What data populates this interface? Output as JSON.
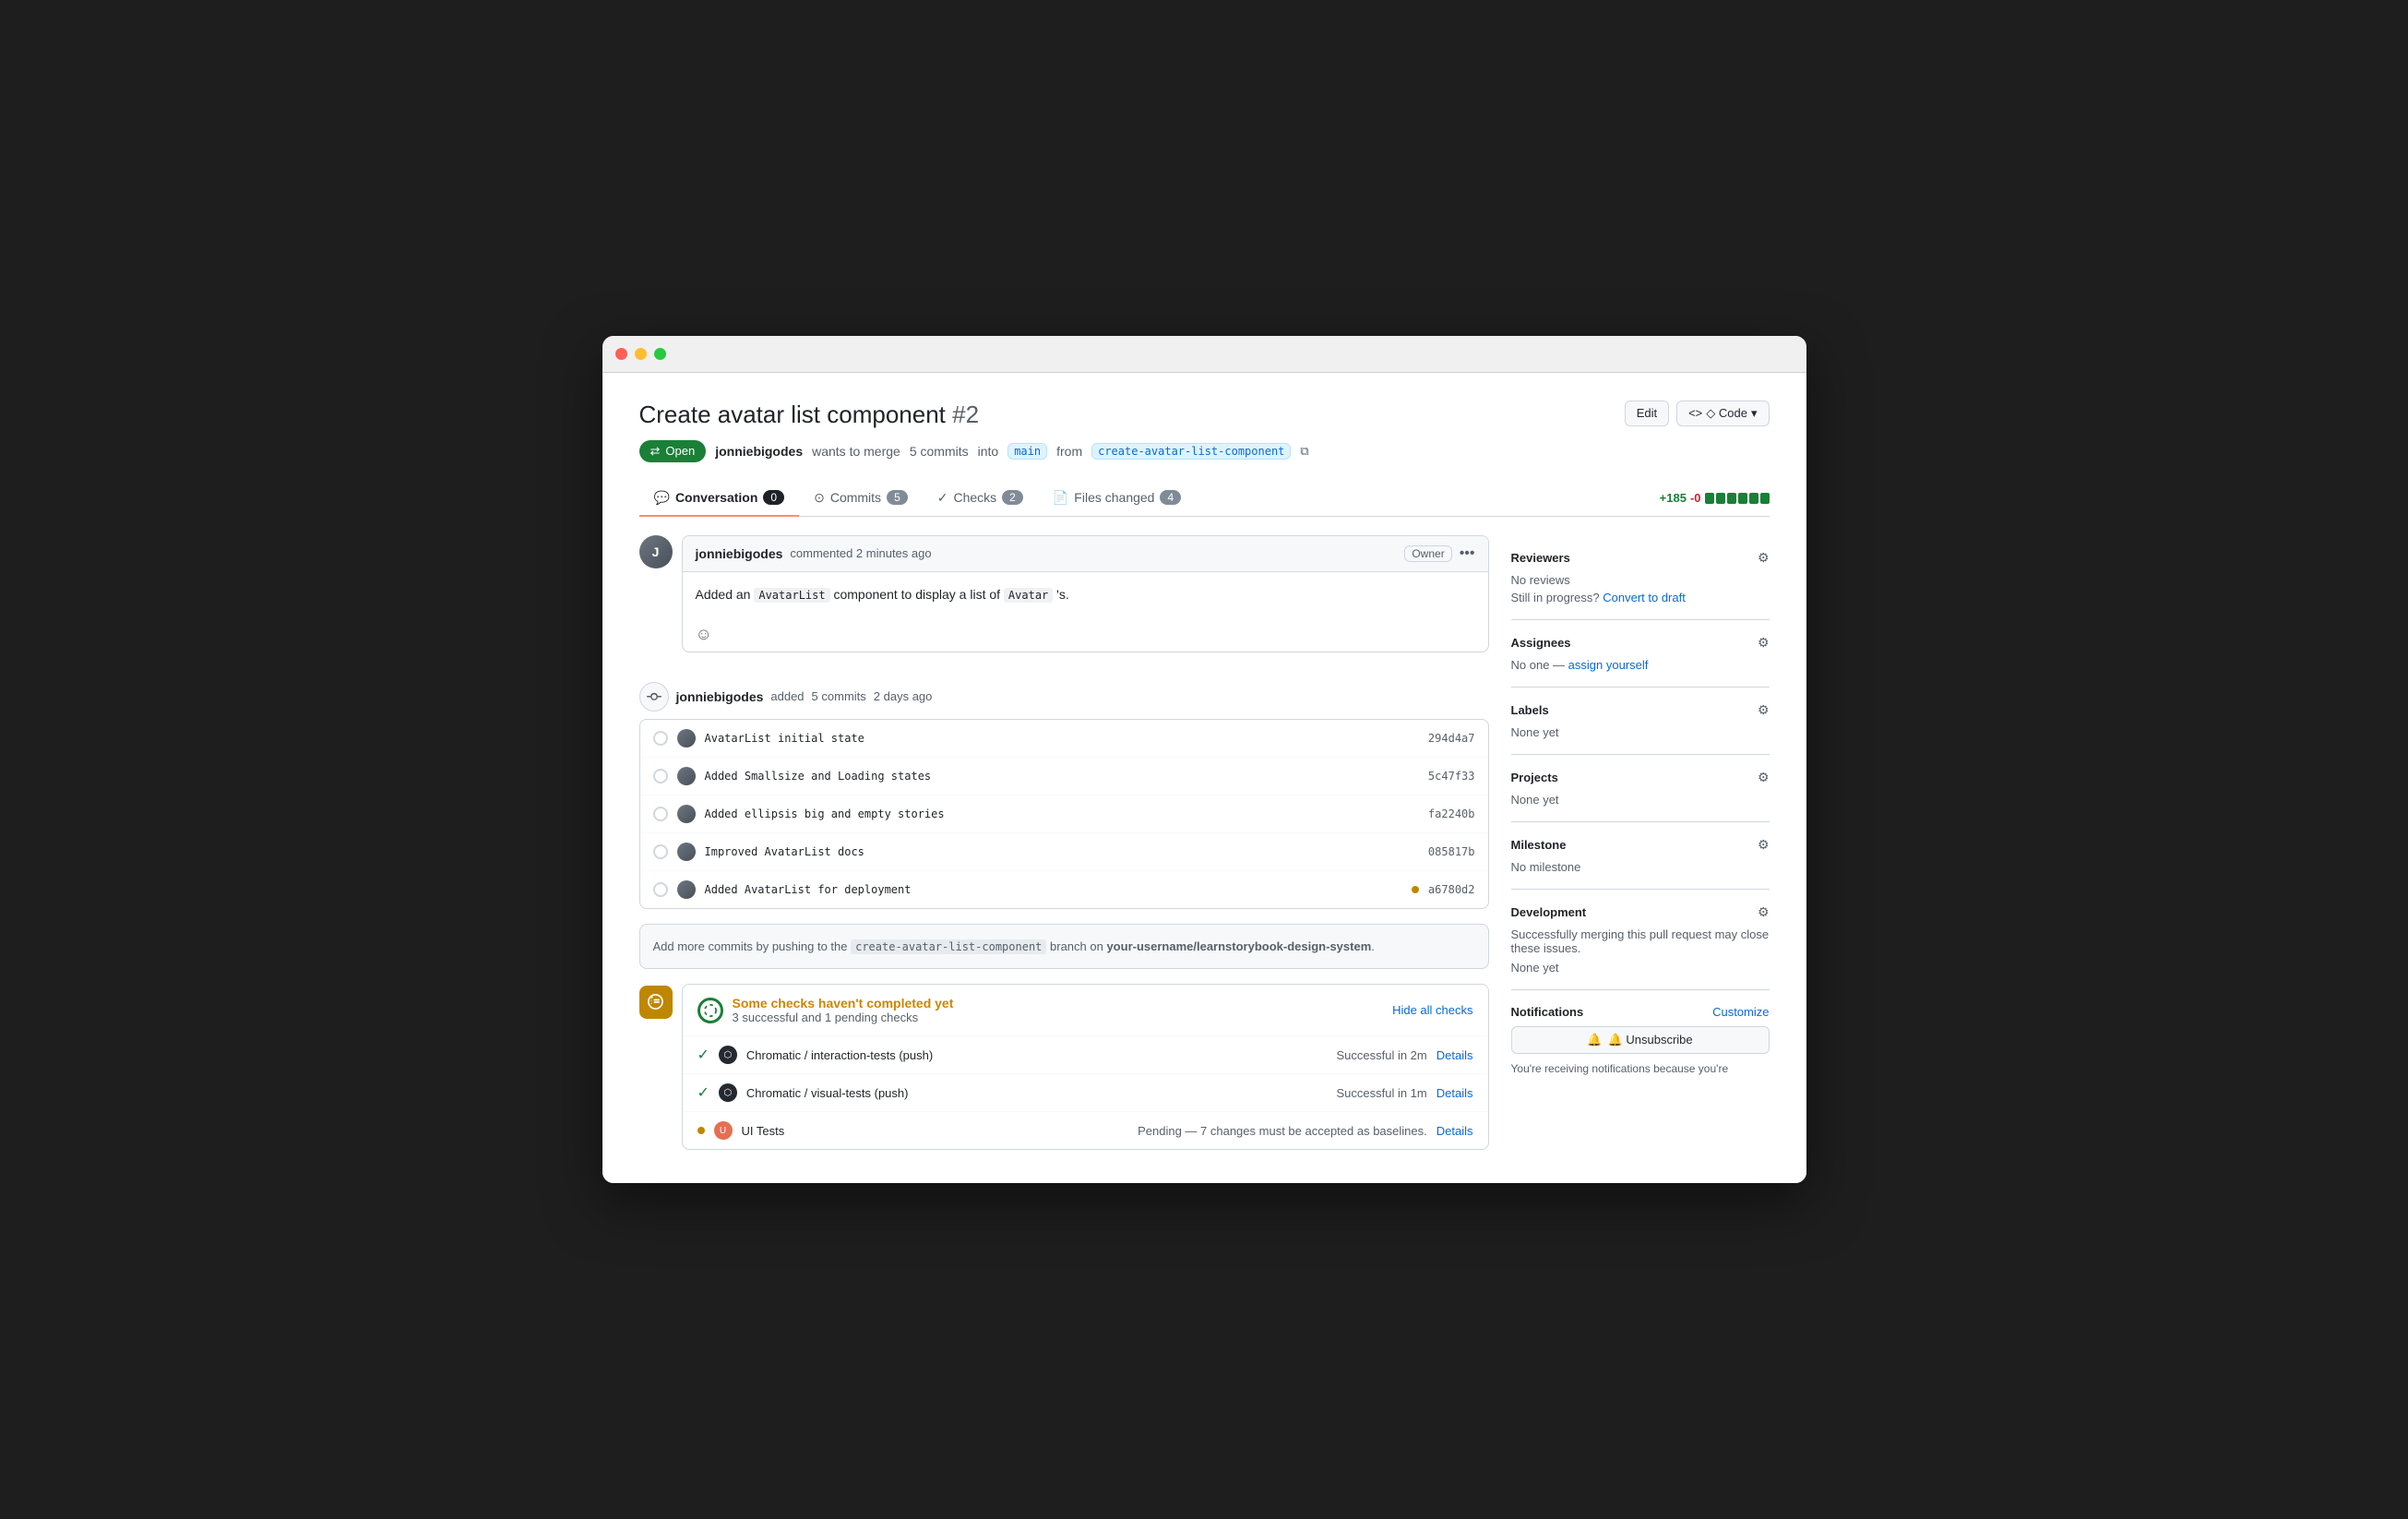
{
  "window": {
    "title": "Create avatar list component #2"
  },
  "header": {
    "pr_title": "Create avatar list component",
    "pr_number": "#2",
    "edit_btn": "Edit",
    "code_btn": "◇ Code",
    "status": "Open",
    "meta": {
      "author": "jonniebigodes",
      "action": "wants to merge",
      "commits_count": "5 commits",
      "into_label": "into",
      "base_branch": "main",
      "from_label": "from",
      "head_branch": "create-avatar-list-component"
    }
  },
  "tabs": {
    "conversation": {
      "label": "Conversation",
      "count": "0"
    },
    "commits": {
      "label": "Commits",
      "count": "5"
    },
    "checks": {
      "label": "Checks",
      "count": "2"
    },
    "files_changed": {
      "label": "Files changed",
      "count": "4"
    }
  },
  "diff_stat": {
    "additions": "+185",
    "deletions": "-0",
    "bars": [
      "green",
      "green",
      "green",
      "green",
      "green",
      "green"
    ]
  },
  "comment": {
    "author": "jonniebigodes",
    "time": "commented 2 minutes ago",
    "owner_label": "Owner",
    "body_text": "Added an AvatarList component to display a list of Avatar 's.",
    "inline_1": "AvatarList",
    "inline_2": "Avatar"
  },
  "commits_section": {
    "author": "jonniebigodes",
    "action": "added",
    "commits_count": "5 commits",
    "time": "2 days ago",
    "items": [
      {
        "message": "AvatarList initial state",
        "hash": "294d4a7",
        "status": ""
      },
      {
        "message": "Added Smallsize and Loading states",
        "hash": "5c47f33",
        "status": ""
      },
      {
        "message": "Added ellipsis big and empty stories",
        "hash": "fa2240b",
        "status": ""
      },
      {
        "message": "Improved AvatarList docs",
        "hash": "085817b",
        "status": ""
      },
      {
        "message": "Added AvatarList for deployment",
        "hash": "a6780d2",
        "status": "pending"
      }
    ]
  },
  "push_message": {
    "text": "Add more commits by pushing to the create-avatar-list-component branch on your-username/learnstorybook-design-system.",
    "branch": "create-avatar-list-component",
    "repo": "your-username/learnstorybook-design-system"
  },
  "checks_section": {
    "title": "Some checks haven't completed yet",
    "subtitle": "3 successful and 1 pending checks",
    "hide_btn": "Hide all checks",
    "items": [
      {
        "name": "Chromatic / interaction-tests (push)",
        "status_text": "Successful in 2m",
        "status": "success",
        "details": "Details"
      },
      {
        "name": "Chromatic / visual-tests (push)",
        "status_text": "Successful in 1m",
        "status": "success",
        "details": "Details"
      },
      {
        "name": "UI Tests",
        "status_text": "Pending — 7 changes must be accepted as baselines.",
        "status": "pending",
        "details": "Details"
      }
    ]
  },
  "sidebar": {
    "reviewers": {
      "title": "Reviewers",
      "value": "No reviews",
      "sub": "Still in progress?",
      "convert_link": "Convert to draft"
    },
    "assignees": {
      "title": "Assignees",
      "value": "No one",
      "assign_link": "assign yourself"
    },
    "labels": {
      "title": "Labels",
      "value": "None yet"
    },
    "projects": {
      "title": "Projects",
      "value": "None yet"
    },
    "milestone": {
      "title": "Milestone",
      "value": "No milestone"
    },
    "development": {
      "title": "Development",
      "desc": "Successfully merging this pull request may close these issues.",
      "value": "None yet"
    },
    "notifications": {
      "title": "Notifications",
      "customize": "Customize",
      "unsubscribe_btn": "🔔 Unsubscribe",
      "note": "You're receiving notifications because you're"
    }
  }
}
